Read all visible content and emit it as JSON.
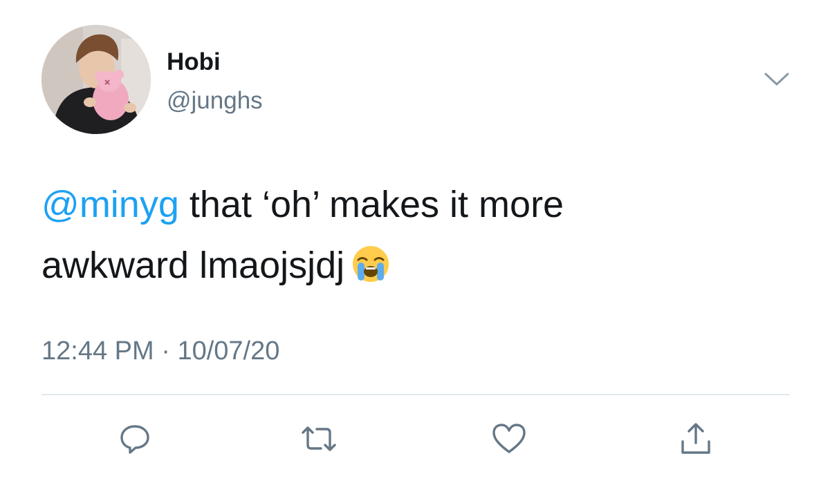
{
  "user": {
    "display_name": "Hobi",
    "handle": "@junghs"
  },
  "tweet": {
    "mention": "@minyg",
    "text_line1": " that ‘oh’ makes it more",
    "text_line2": "awkward lmaojsjdj",
    "emoji": "loudly-crying-face",
    "time": "12:44 PM",
    "separator": " · ",
    "date": "10/07/20"
  },
  "actions": {
    "icons": [
      "reply-icon",
      "retweet-icon",
      "like-icon",
      "share-icon"
    ]
  },
  "colors": {
    "text": "#14171a",
    "secondary": "#657786",
    "link": "#1da1f2",
    "divider": "#e1e8ed"
  }
}
